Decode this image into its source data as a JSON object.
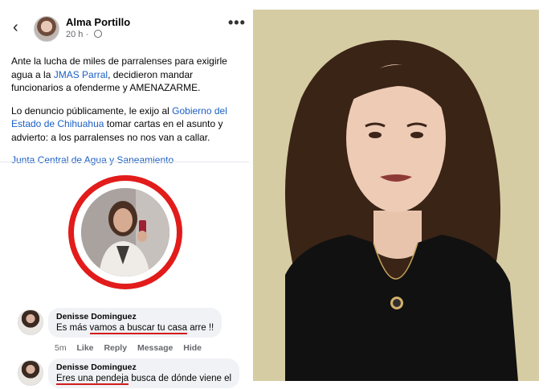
{
  "post": {
    "author": "Alma Portillo",
    "time": "20 h",
    "more": "•••",
    "back": "‹",
    "p1_a": "Ante la lucha de miles de parralenses para exigirle agua a la ",
    "p1_link": "JMAS Parral",
    "p1_b": ", decidieron mandar funcionarios a ofenderme y AMENAZARME.",
    "p2_a": "Lo denuncio públicamente, le exijo al ",
    "p2_link": "Gobierno del Estado de Chihuahua",
    "p2_b": " tomar cartas en el asunto y advierto: a los parralenses no nos van a callar.",
    "tag_link": "Junta Central de Agua y Saneamiento"
  },
  "comments": [
    {
      "name": "Denisse Dominguez",
      "text_pre": "Es más ",
      "text_underlined": "vamos a buscar tu casa",
      "text_post": " arre !!",
      "time": "5m",
      "like": "Like",
      "reply": "Reply",
      "message": "Message",
      "hide": "Hide"
    },
    {
      "name": "Denisse Dominguez",
      "text_pre": "",
      "text_underlined": "Eres una pendeja",
      "text_post": " busca de dónde viene el"
    }
  ],
  "colors": {
    "link": "#1b5fc4",
    "highlight_ring": "#e21b1b",
    "underline": "#d31c1c"
  }
}
